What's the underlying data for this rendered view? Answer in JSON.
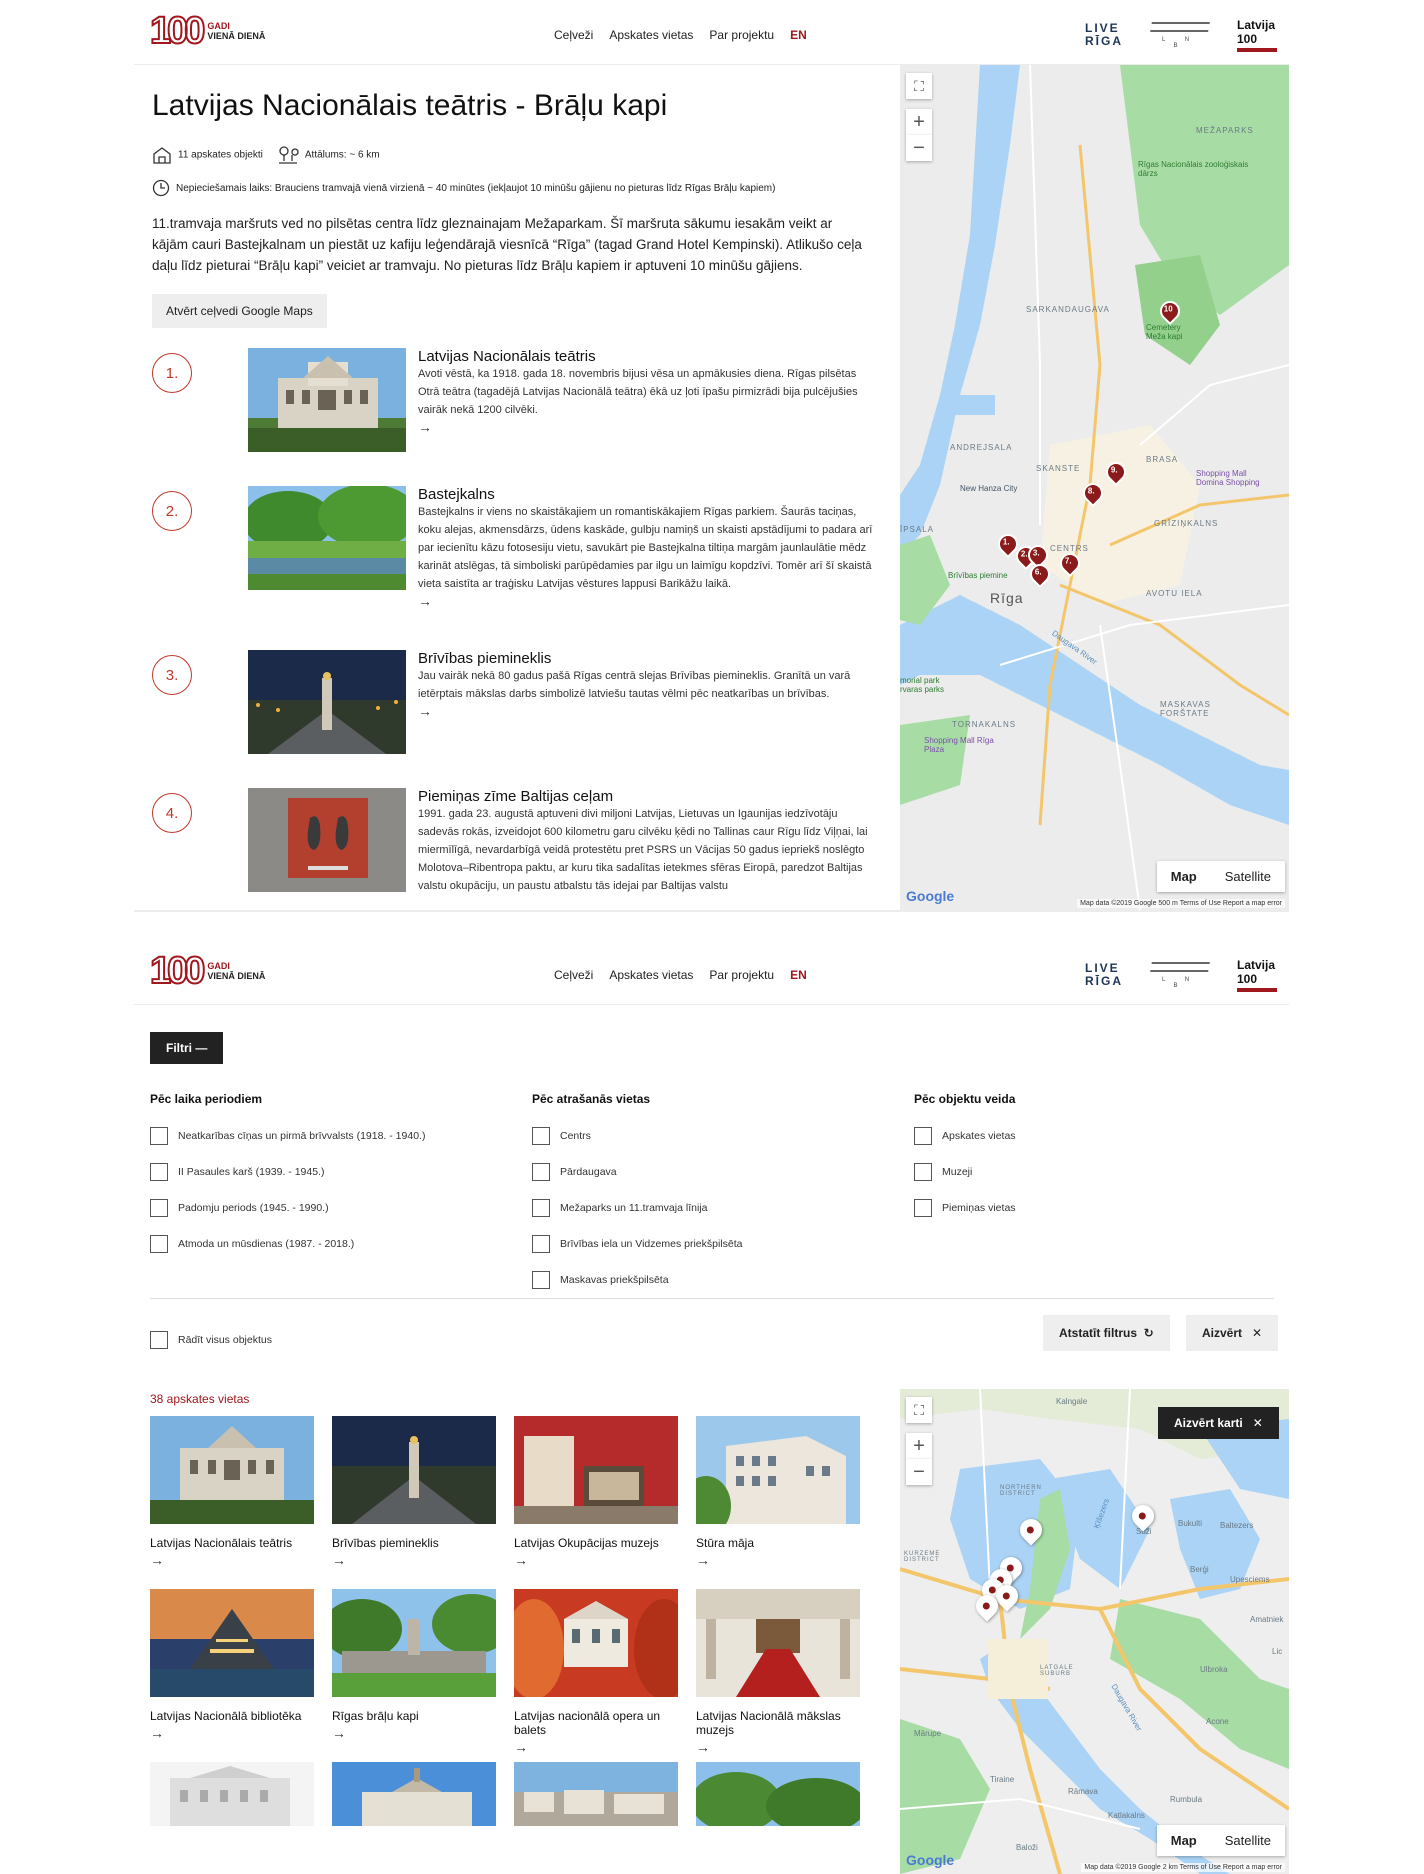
{
  "header": {
    "logo_number": "100",
    "logo_line1": "GADI",
    "logo_line2": "VIENĀ DIENĀ",
    "nav": [
      "Ceļveži",
      "Apskates vietas",
      "Par projektu"
    ],
    "lang": "EN",
    "live_line1": "LIVE",
    "live_line2": "RĪGA",
    "lnb": "L N B",
    "latvija_line1": "Latvija",
    "latvija_line2": "100"
  },
  "route": {
    "title": "Latvijas Nacionālais teātris - Brāļu kapi",
    "objects": "11 apskates objekti",
    "distance": "Attālums: ~ 6 km",
    "time": "Nepieciešamais laiks: Brauciens tramvajā vienā virzienā ~ 40 minūtes (iekļaujot 10 minūšu gājienu no pieturas līdz Rīgas Brāļu kapiem)",
    "intro": "11.tramvaja maršruts ved no pilsētas centra līdz gleznainajam Mežaparkam. Šī maršruta sākumu iesakām veikt ar kājām cauri Bastejkalnam un piestāt uz kafiju leģendārajā viesnīcā “Rīga” (tagad Grand Hotel Kempinski). Atlikušo ceļa daļu līdz pieturai “Brāļu kapi” veiciet ar tramvaju. No pieturas līdz Brāļu kapiem ir aptuveni 10 minūšu gājiens.",
    "maps_button": "Atvērt ceļvedi Google Maps",
    "stops": [
      {
        "num": "1.",
        "title": "Latvijas Nacionālais teātris",
        "desc": "Avoti vēstā, ka 1918. gada 18. novembris bijusi vēsa un apmākusies diena. Rīgas pilsētas Otrā teātra (tagadējā Latvijas Nacionālā teātra) ēkā uz ļoti īpašu pirmizrādi bija pulcējušies vairāk nekā 1200 cilvēki."
      },
      {
        "num": "2.",
        "title": "Bastejkalns",
        "desc": "Bastejkalns ir viens no skaistākajiem un romantiskākajiem Rīgas parkiem. Šaurās taciņas, koku alejas, akmensdārzs, ūdens kaskāde, gulbju namiņš un skaisti apstādījumi to padara arī par iecienītu kāzu fotosesiju vietu, savukārt pie Bastejkalna tiltiņa margām jaunlaulātie mēdz karināt atslēgas, tā simboliski parūpēdamies par ilgu un laimīgu kopdzīvi. Tomēr arī šī skaistā vieta saistīta ar traģisku Latvijas vēstures lappusi Barikāžu laikā."
      },
      {
        "num": "3.",
        "title": "Brīvības piemineklis",
        "desc": "Jau vairāk nekā 80 gadus pašā Rīgas centrā slejas Brīvības piemineklis. Granītā un varā ietērptais mākslas darbs simbolizē latviešu tautas vēlmi pēc neatkarības un brīvības."
      },
      {
        "num": "4.",
        "title": "Piemiņas zīme Baltijas ceļam",
        "desc": "1991. gada 23. augustā aptuveni divi miljoni Latvijas, Lietuvas un Igaunijas iedzīvotāju sadevās rokās, izveidojot 600 kilometru garu cilvēku ķēdi no Tallinas caur Rīgu līdz Viļņai, lai miermīlīgā, nevardarbīgā veidā protestētu pret PSRS un Vācijas 50 gadus iepriekš noslēgto Molotova–Ribentropa paktu, ar kuru tika sadalītas ietekmes sfēras Eiropā, paredzot Baltijas valstu okupāciju, un paustu atbalstu tās idejai par Baltijas valstu"
      }
    ],
    "arrow": "→"
  },
  "map1": {
    "zoom_in": "+",
    "zoom_out": "−",
    "labels": [
      "MEŽAPARKS",
      "Rīgas Nacionālais zooloģiskais dārzs",
      "SARKANDAUGAVA",
      "Cemetery Meža kapi",
      "ANDREJSALA",
      "SKANSTE",
      "BRASA",
      "New Hanza City",
      "Shopping Mall Domina Shopping",
      "GRĪZIŅKALNS",
      "CENTRS",
      "Brīvības piemine",
      "Rīga",
      "AVOTU IELA",
      "ĪPSALA",
      "MASKAVAS FORŠTATE",
      "TORNAKALNS",
      "Shopping Mall Rīga Plaza",
      "Daugava River",
      "morial park rvaras parks"
    ],
    "pins": [
      "1.",
      "2.",
      "3.",
      "6.",
      "7.",
      "8.",
      "9.",
      "10"
    ],
    "map_btn": "Map",
    "sat_btn": "Satellite",
    "google": "Google",
    "attribution": "Map data ©2019 Google   500 m   Terms of Use   Report a map error"
  },
  "filters": {
    "toggle": "Filtri",
    "col1": {
      "title": "Pēc laika periodiem",
      "items": [
        "Neatkarības cīņas un pirmā brīvvalsts (1918. - 1940.)",
        "II Pasaules karš (1939. - 1945.)",
        "Padomju periods (1945. - 1990.)",
        "Atmoda un mūsdienas (1987. - 2018.)"
      ]
    },
    "col2": {
      "title": "Pēc atrašanās vietas",
      "items": [
        "Centrs",
        "Pārdaugava",
        "Mežaparks un 11.tramvaja līnija",
        "Brīvības iela un Vidzemes priekšpilsēta",
        "Maskavas priekšpilsēta"
      ]
    },
    "col3": {
      "title": "Pēc objektu veida",
      "items": [
        "Apskates vietas",
        "Muzeji",
        "Piemiņas vietas"
      ]
    },
    "show_all": "Rādīt visus objektus",
    "reset": "Atstatīt filtrus",
    "reset_icon": "↻",
    "close": "Aizvērt",
    "close_icon": "✕"
  },
  "results": {
    "count": "38 apskates vietas",
    "cards": [
      "Latvijas Nacionālais teātris",
      "Brīvības piemineklis",
      "Latvijas Okupācijas muzejs",
      "Stūra māja",
      "Latvijas Nacionālā bibliotēka",
      "Rīgas brāļu kapi",
      "Latvijas nacionālā opera un balets",
      "Latvijas Nacionālā mākslas muzejs",
      "",
      "",
      "",
      ""
    ]
  },
  "map2": {
    "close_map": "Aizvērt karti",
    "close_icon": "✕",
    "labels": [
      "Kalngale",
      "NORTHERN DISTRICT",
      "Ķīšezers",
      "Suži",
      "Bukulti",
      "Baltezers",
      "KURZEME DISTRICT",
      "Berģi",
      "Upesciems",
      "Amatniek",
      "Lic",
      "Ulbroka",
      "Acone",
      "Mārupe",
      "Tiraine",
      "Rāmava",
      "Katlakalns",
      "Rumbula",
      "Baloži",
      "LATGALE SUBURB",
      "Daugava River"
    ],
    "roads": [
      "A4",
      "A2",
      "A10",
      "A8",
      "A7",
      "P2",
      "P4",
      "P5",
      "P132",
      "A5"
    ],
    "map_btn": "Map",
    "sat_btn": "Satellite",
    "google": "Google",
    "attribution": "Map data ©2019 Google   2 km   Terms of Use   Report a map error"
  }
}
